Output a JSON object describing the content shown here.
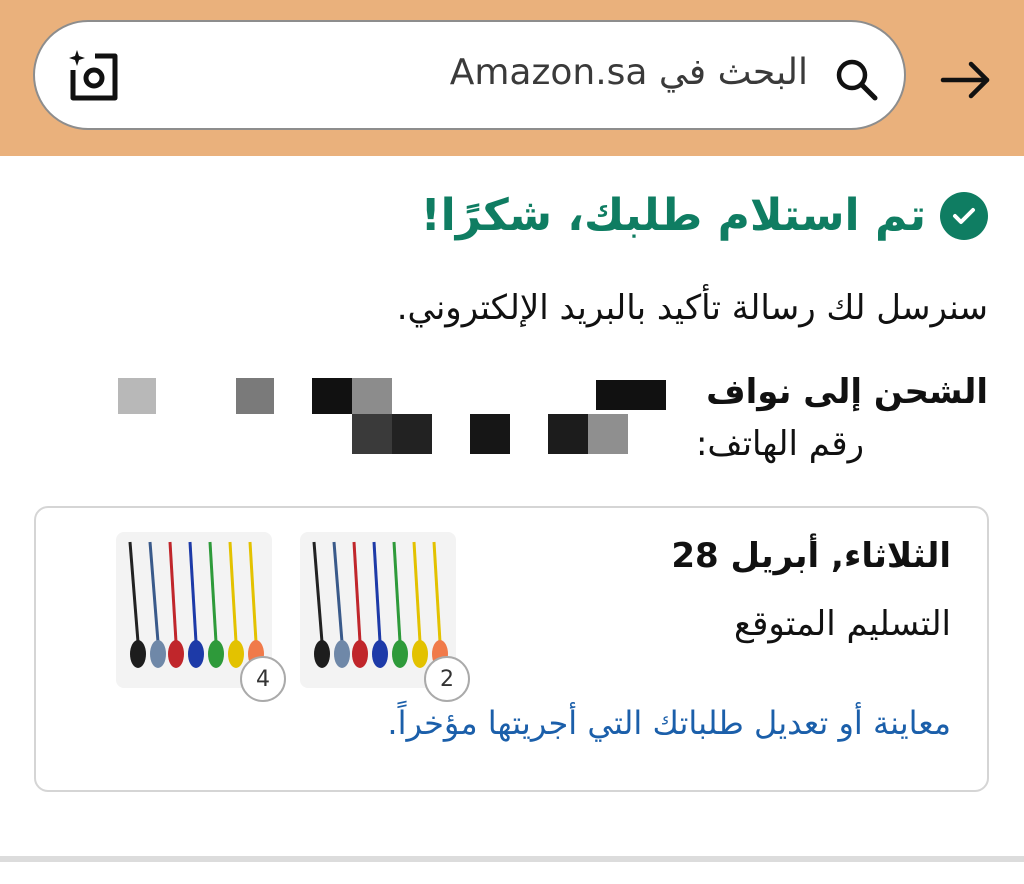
{
  "search": {
    "placeholder": "البحث في Amazon.sa"
  },
  "confirmation": {
    "title": "تم استلام طلبك، شكرًا!",
    "subtitle": "سنرسل لك رسالة تأكيد بالبريد الإلكتروني.",
    "ship_to": "الشحن إلى نواف",
    "phone_label": "رقم الهاتف:"
  },
  "delivery": {
    "date": "الثلاثاء, أبريل 28",
    "label": "التسليم المتوقع",
    "items": [
      {
        "qty": "2"
      },
      {
        "qty": "4"
      }
    ],
    "manage_link": "معاينة أو تعديل طلباتك التي أجريتها مؤخراً."
  },
  "colors": {
    "header_bg": "#eab17c",
    "success_green": "#0f7d62",
    "link_blue": "#1b5faa"
  },
  "icons": {
    "search": "search-icon",
    "camera": "camera-icon",
    "arrow": "arrow-right-icon",
    "check": "check-circle-icon"
  }
}
